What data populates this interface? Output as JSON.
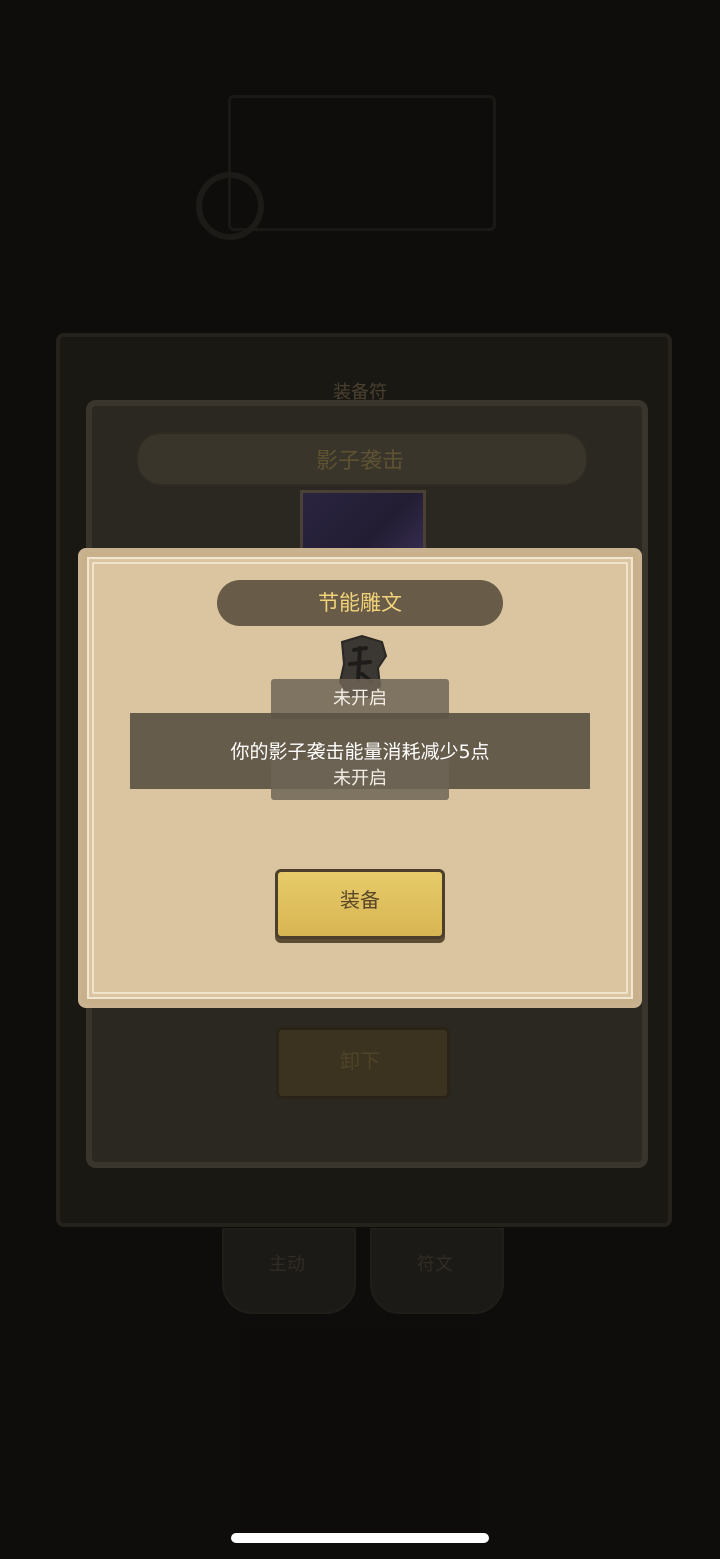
{
  "background": {
    "panel_title": "装备符",
    "skill_name": "影子袭击",
    "unequip_label": "卸下",
    "tabs": [
      {
        "label": "主动"
      },
      {
        "label": "符文"
      }
    ]
  },
  "dialog": {
    "title": "节能雕文",
    "status_top": "未开启",
    "description": "你的影子袭击能量消耗减少5点",
    "status_bottom": "未开启",
    "equip_label": "装备"
  },
  "colors": {
    "dialog_bg": "#dbc5a1",
    "banner": "#685b48",
    "title_gold": "#f2d37a",
    "equip_button": "#e0c05e"
  }
}
